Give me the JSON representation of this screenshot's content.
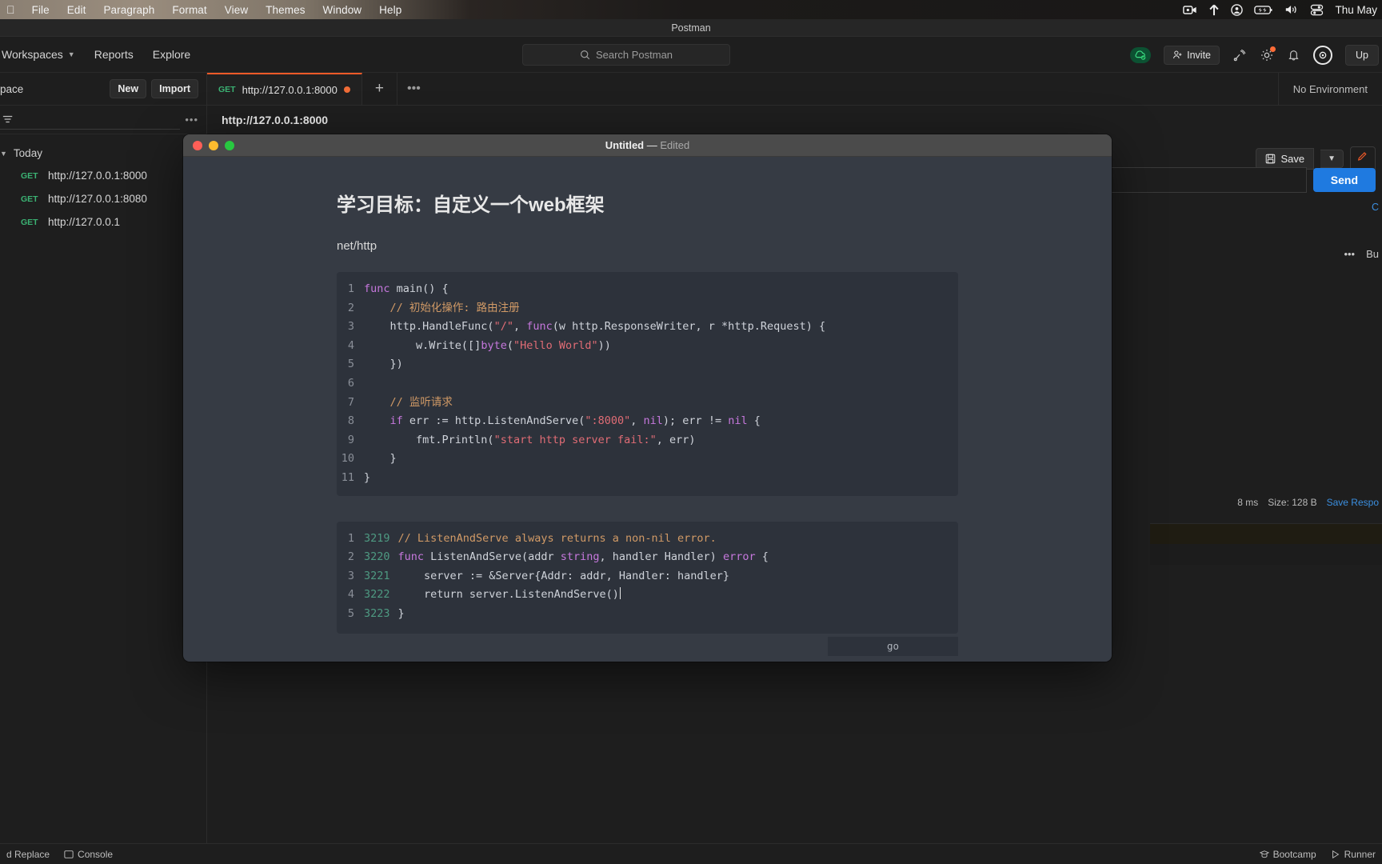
{
  "menubar": {
    "apple": "●",
    "items": [
      "File",
      "Edit",
      "Paragraph",
      "Format",
      "View",
      "Themes",
      "Window",
      "Help"
    ],
    "status_icons": [
      "video-camera-icon",
      "upload-arrow-icon",
      "user-circle-icon",
      "battery-icon",
      "volume-icon",
      "control-center-icon"
    ],
    "clock": "Thu May"
  },
  "postman": {
    "window_title": "Postman",
    "nav": {
      "workspaces": "Workspaces",
      "reports": "Reports",
      "explore": "Explore",
      "search_placeholder": "Search Postman",
      "invite": "Invite",
      "upgrade": "Up"
    },
    "sidebar": {
      "workspace_label": "pace",
      "new_button": "New",
      "import_button": "Import",
      "group_label": "Today",
      "items": [
        {
          "method": "GET",
          "url": "http://127.0.0.1:8000"
        },
        {
          "method": "GET",
          "url": "http://127.0.0.1:8080"
        },
        {
          "method": "GET",
          "url": "http://127.0.0.1"
        }
      ]
    },
    "tabs": [
      {
        "method": "GET",
        "label": "http://127.0.0.1:8000",
        "unsaved": true
      }
    ],
    "environment": "No Environment",
    "request_title": "http://127.0.0.1:8000",
    "save_label": "Save",
    "send_label": "Send",
    "cookies_label": "C",
    "body_more": "•••",
    "body_tab": "Bu",
    "response_time": "8 ms",
    "response_size": "Size: 128 B",
    "save_response": "Save Respo",
    "statusbar": {
      "find_replace": "d Replace",
      "console": "Console",
      "bootcamp": "Bootcamp",
      "runner": "Runner"
    }
  },
  "editor": {
    "title": "Untitled",
    "dash": "—",
    "edited": "Edited",
    "heading": "学习目标：自定义一个web框架",
    "paragraph": "net/http",
    "lang_tag": "go",
    "code_block_1": [
      {
        "n": "1",
        "segments": [
          {
            "t": "func ",
            "c": "kw"
          },
          {
            "t": "main() {",
            "c": "fn"
          }
        ]
      },
      {
        "n": "2",
        "segments": [
          {
            "t": "    // 初始化操作: 路由注册",
            "c": "com"
          }
        ]
      },
      {
        "n": "3",
        "segments": [
          {
            "t": "    http.HandleFunc(",
            "c": "fn"
          },
          {
            "t": "\"/\"",
            "c": "str"
          },
          {
            "t": ", ",
            "c": "fn"
          },
          {
            "t": "func",
            "c": "kw"
          },
          {
            "t": "(w http.ResponseWriter, r *http.Request) {",
            "c": "fn"
          }
        ]
      },
      {
        "n": "4",
        "segments": [
          {
            "t": "        w.Write([]",
            "c": "fn"
          },
          {
            "t": "byte",
            "c": "kw"
          },
          {
            "t": "(",
            "c": "fn"
          },
          {
            "t": "\"Hello World\"",
            "c": "str"
          },
          {
            "t": "))",
            "c": "fn"
          }
        ]
      },
      {
        "n": "5",
        "segments": [
          {
            "t": "    })",
            "c": "fn"
          }
        ]
      },
      {
        "n": "6",
        "segments": [
          {
            "t": "",
            "c": "fn"
          }
        ]
      },
      {
        "n": "7",
        "segments": [
          {
            "t": "    // 监听请求",
            "c": "com"
          }
        ]
      },
      {
        "n": "8",
        "segments": [
          {
            "t": "    ",
            "c": "fn"
          },
          {
            "t": "if",
            "c": "kw"
          },
          {
            "t": " err := http.ListenAndServe(",
            "c": "fn"
          },
          {
            "t": "\":8000\"",
            "c": "str"
          },
          {
            "t": ", ",
            "c": "fn"
          },
          {
            "t": "nil",
            "c": "kw"
          },
          {
            "t": "); err != ",
            "c": "fn"
          },
          {
            "t": "nil",
            "c": "kw"
          },
          {
            "t": " {",
            "c": "fn"
          }
        ]
      },
      {
        "n": "9",
        "segments": [
          {
            "t": "        fmt.Println(",
            "c": "fn"
          },
          {
            "t": "\"start http server fail:\"",
            "c": "str"
          },
          {
            "t": ", err)",
            "c": "fn"
          }
        ]
      },
      {
        "n": "10",
        "segments": [
          {
            "t": "    }",
            "c": "fn"
          }
        ]
      },
      {
        "n": "11",
        "segments": [
          {
            "t": "}",
            "c": "fn"
          }
        ]
      }
    ],
    "code_block_2": [
      {
        "n": "1",
        "n2": "3219",
        "segments": [
          {
            "t": "// ListenAndServe always returns a non-nil error.",
            "c": "com"
          }
        ]
      },
      {
        "n": "2",
        "n2": "3220",
        "segments": [
          {
            "t": "func",
            "c": "kw"
          },
          {
            "t": " ListenAndServe(addr ",
            "c": "fn"
          },
          {
            "t": "string",
            "c": "kw"
          },
          {
            "t": ", handler Handler) ",
            "c": "fn"
          },
          {
            "t": "error",
            "c": "kw"
          },
          {
            "t": " {",
            "c": "fn"
          }
        ]
      },
      {
        "n": "3",
        "n2": "3221",
        "segments": [
          {
            "t": "    server := &Server{Addr: addr, Handler: handler}",
            "c": "fn"
          }
        ]
      },
      {
        "n": "4",
        "n2": "3222",
        "segments": [
          {
            "t": "    return server.ListenAndServe()",
            "c": "fn"
          },
          {
            "t": "",
            "c": "caret"
          }
        ]
      },
      {
        "n": "5",
        "n2": "3223",
        "segments": [
          {
            "t": "}",
            "c": "fn"
          }
        ]
      }
    ]
  },
  "colors": {
    "accent_orange": "#f05a28",
    "send_blue": "#1f7ae0",
    "method_green": "#3bb273",
    "code_bg": "#2d323b",
    "editor_bg": "#363b44"
  }
}
